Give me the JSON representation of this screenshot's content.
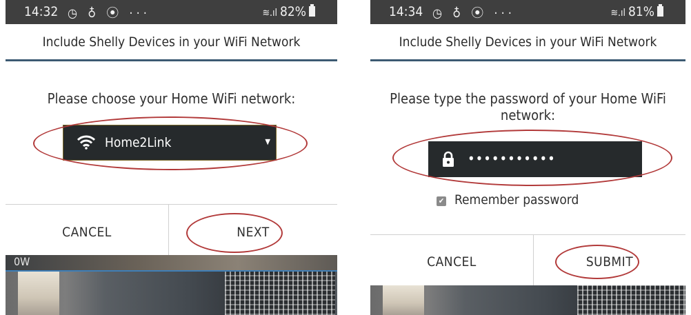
{
  "left": {
    "status": {
      "time": "14:32",
      "icons": "Ⓢ ♧ ☉ ···",
      "battery": "82%"
    },
    "title": "Include Shelly Devices in your WiFi Network",
    "prompt": "Please choose your Home WiFi network:",
    "network_select": {
      "selected": "Home2Link",
      "icon": "wifi-icon"
    },
    "cancel_label": "CANCEL",
    "next_label": "NEXT",
    "power_readout": "0W"
  },
  "right": {
    "status": {
      "time": "14:34",
      "icons": "Ⓢ ♧ ☉ ···",
      "battery": "81%"
    },
    "title": "Include Shelly Devices in your WiFi Network",
    "prompt": "Please type the password of your Home WiFi network:",
    "password": {
      "masked_value": "•••••••••••",
      "icon": "lock-icon"
    },
    "remember": {
      "label": "Remember password",
      "checked": true
    },
    "cancel_label": "CANCEL",
    "submit_label": "SUBMIT"
  },
  "colors": {
    "status_bar": "#3f3f3f",
    "title_rule": "#3c5a72",
    "field_bg": "#262a2c",
    "highlight_ellipse": "#b23a3a"
  }
}
